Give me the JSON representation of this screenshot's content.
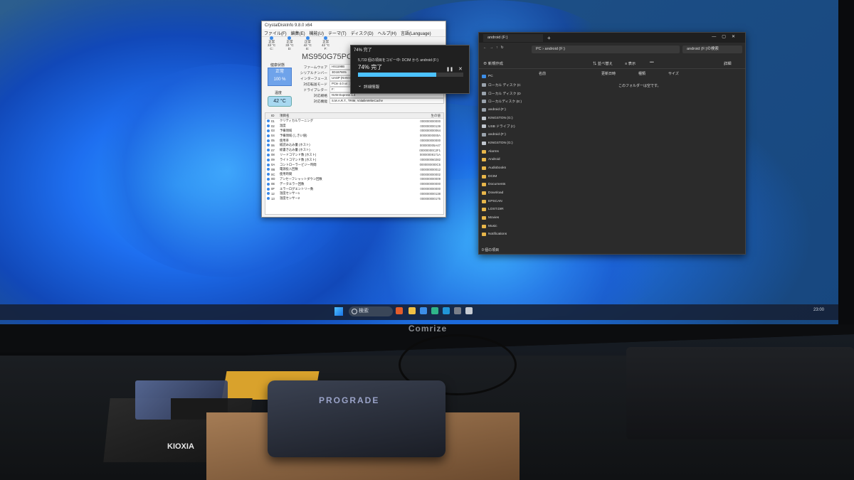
{
  "monitor": {
    "brand": "Comrize"
  },
  "taskbar": {
    "search": "検索",
    "tray_time": "23:00"
  },
  "crystaldiskinfo": {
    "title": "CrystalDiskInfo 9.8.0 x64",
    "menu": [
      "ファイル(F)",
      "編集(E)",
      "機能(U)",
      "テーマ(T)",
      "ディスク(D)",
      "ヘルプ(H)",
      "言語(Language)"
    ],
    "drives": [
      {
        "status": "正常",
        "temp": "33 °C",
        "letter": "C:"
      },
      {
        "status": "正常",
        "temp": "33 °C",
        "letter": "D:"
      },
      {
        "status": "正常",
        "temp": "42 °C",
        "letter": "E:"
      },
      {
        "status": "正常",
        "temp": "42 °C",
        "letter": "F:"
      }
    ],
    "model": "MS950G75PCIe4",
    "health_label": "健康状態",
    "health_status": "正常",
    "health_percent": "100 %",
    "temp_label": "温度",
    "temperature": "42 °C",
    "info": [
      {
        "key": "ファームウェア",
        "value": "HS1198B"
      },
      {
        "key": "シリアルナンバー",
        "value": "3D1B7B05"
      },
      {
        "key": "インターフェース",
        "value": "UASP (NVM Express)"
      },
      {
        "key": "対応転送モード",
        "value": "PCIe 4.0 x4 | PCIe 4.0 x4"
      },
      {
        "key": "ドライブレター",
        "value": "F:"
      },
      {
        "key": "対応規格",
        "value": "NVM Express 1.4"
      },
      {
        "key": "対応機能",
        "value": "S.M.A.R.T., TRIM, VolatileWriteCache"
      }
    ],
    "smart_header": {
      "id": "ID",
      "name": "項目名",
      "raw": "生の値"
    },
    "smart": [
      {
        "id": "01",
        "name": "クリティカルワーニング",
        "raw": "000000000000"
      },
      {
        "id": "02",
        "name": "温度",
        "raw": "000000000139"
      },
      {
        "id": "03",
        "name": "予備領域",
        "raw": "000000000064"
      },
      {
        "id": "04",
        "name": "予備領域 (しきい値)",
        "raw": "00000000000A"
      },
      {
        "id": "05",
        "name": "使用率",
        "raw": "000000000000"
      },
      {
        "id": "06",
        "name": "総読み込み量 (ホスト)",
        "raw": "000000005A47"
      },
      {
        "id": "07",
        "name": "総書き込み量 (ホスト)",
        "raw": "00000000C2F1"
      },
      {
        "id": "08",
        "name": "リードコマンド数 (ホスト)",
        "raw": "00000008171A"
      },
      {
        "id": "09",
        "name": "ライトコマンド数 (ホスト)",
        "raw": "000000060282"
      },
      {
        "id": "0A",
        "name": "コントローラービジー時間",
        "raw": "0000000000C5"
      },
      {
        "id": "0B",
        "name": "電源投入回数",
        "raw": "000000000012"
      },
      {
        "id": "0C",
        "name": "使用時間",
        "raw": "000000000002"
      },
      {
        "id": "0D",
        "name": "アンセーフシャットダウン回数",
        "raw": "000000000009"
      },
      {
        "id": "0E",
        "name": "データエラー回数",
        "raw": "000000000000"
      },
      {
        "id": "0F",
        "name": "エラーログエントリー数",
        "raw": "000000000000"
      },
      {
        "id": "12",
        "name": "温度センサー1",
        "raw": "000000000138"
      },
      {
        "id": "13",
        "name": "温度センサー2",
        "raw": "000000000175"
      }
    ]
  },
  "copy_dialog": {
    "title": "74% 完了",
    "description": "5,733 個の項目をコピー中: DCIM から android (F:)",
    "big_status": "74% 完了",
    "progress": 0.74,
    "details": "詳細情報"
  },
  "explorer": {
    "tab_title": "android (F:)",
    "address": [
      "PC",
      "android (F:)"
    ],
    "search_placeholder": "android (F:)の検索",
    "toolbar": {
      "new": "新規作成",
      "sort": "並べ替え",
      "view": "表示",
      "more": "•••",
      "details": "詳細"
    },
    "columns": [
      "名前",
      "更新日時",
      "種類",
      "サイズ"
    ],
    "empty_message": "このフォルダーは空です。",
    "status": "0 個の項目",
    "nav": [
      {
        "label": "PC",
        "icon": "pc-icon"
      },
      {
        "label": "ローカル ディスク (C",
        "icon": "drive-icon"
      },
      {
        "label": "ローカル ディスク (D",
        "icon": "drive-icon"
      },
      {
        "label": "ローカルディスク (E:)",
        "icon": "drive-icon"
      },
      {
        "label": "android (F:)",
        "icon": "drive-icon"
      },
      {
        "label": "KINGSTON (G:)",
        "icon": "usb-icon"
      },
      {
        "label": "USB ドライブ (I:)",
        "icon": "usb-icon"
      },
      {
        "label": "android (F:)",
        "icon": "drive-icon"
      },
      {
        "label": "KINGSTON (G:)",
        "icon": "usb-icon"
      },
      {
        "label": "Alarms",
        "icon": "folder-icon"
      },
      {
        "label": "Android",
        "icon": "folder-icon"
      },
      {
        "label": "Audiobooks",
        "icon": "folder-icon"
      },
      {
        "label": "DCIM",
        "icon": "folder-icon"
      },
      {
        "label": "Documents",
        "icon": "folder-icon"
      },
      {
        "label": "Download",
        "icon": "folder-icon"
      },
      {
        "label": "EPSCAN",
        "icon": "folder-icon"
      },
      {
        "label": "LOST.DIR",
        "icon": "folder-icon"
      },
      {
        "label": "Movies",
        "icon": "folder-icon"
      },
      {
        "label": "Music",
        "icon": "folder-icon"
      },
      {
        "label": "Notifications",
        "icon": "folder-icon"
      }
    ]
  },
  "desk": {
    "kioxia_label": "KIOXIA",
    "device_label": "PROGRADE"
  },
  "colors": {
    "accent": "#4cc2ff",
    "folder": "#e8b64a",
    "win_blue": "#1e6ff0"
  }
}
